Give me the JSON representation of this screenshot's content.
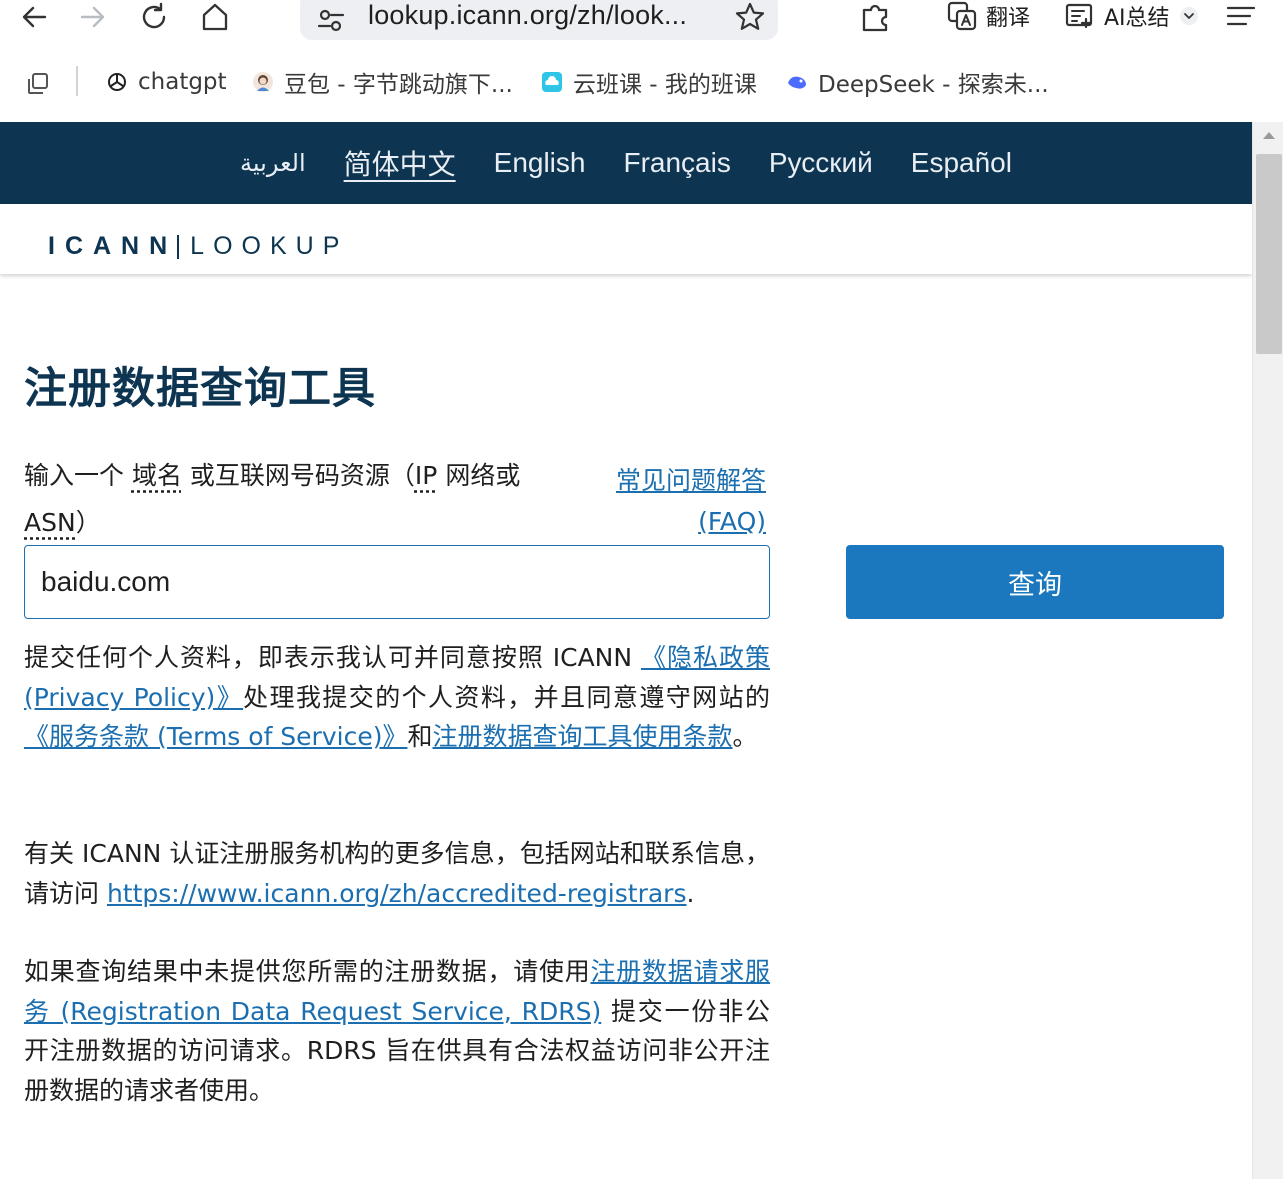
{
  "browser": {
    "url": "lookup.icann.org/zh/look...",
    "translate_label": "翻译",
    "ai_summary_label": "AI总结",
    "bookmarks": [
      {
        "label": "chatgpt",
        "icon": "openai-icon"
      },
      {
        "label": "豆包 - 字节跳动旗下...",
        "icon": "doubao-icon"
      },
      {
        "label": "云班课 - 我的班课",
        "icon": "cloud-class-icon"
      },
      {
        "label": "DeepSeek - 探索未...",
        "icon": "deepseek-icon"
      }
    ]
  },
  "languages": [
    {
      "label": "العربية",
      "active": false
    },
    {
      "label": "简体中文",
      "active": true
    },
    {
      "label": "English",
      "active": false
    },
    {
      "label": "Français",
      "active": false
    },
    {
      "label": "Русский",
      "active": false
    },
    {
      "label": "Español",
      "active": false
    }
  ],
  "brand": {
    "left": "ICANN",
    "right": "LOOKUP"
  },
  "page": {
    "title": "注册数据查询工具",
    "prompt": {
      "t1": "输入一个 ",
      "domain": "域名",
      "t2": " 或互联网号码资源（",
      "ip": "IP",
      "t3": " 网络或 ",
      "asn": "ASN",
      "t4": "）"
    },
    "faq_line1": "常见问题解答",
    "faq_line2": "(FAQ)",
    "search_value": "baidu.com",
    "submit_label": "查询",
    "p1": {
      "t1": "提交任何个人资料，即表示我认可并同意按照 ICANN ",
      "privacy_link": "《隐私政策 (Privacy Policy)》",
      "t2": "处理我提交的个人资料，并且同意遵守网站的",
      "tos_link": "《服务条款 (Terms of Service)》",
      "t3": "和",
      "terms_link": "注册数据查询工具使用条款",
      "t4": "。"
    },
    "p2": {
      "t1": "有关 ICANN 认证注册服务机构的更多信息，包括网站和联系信息，请访问 ",
      "link": "https://www.icann.org/zh/accredited-registrars",
      "t2": "."
    },
    "p3": {
      "t1": "如果查询结果中未提供您所需的注册数据，请使用",
      "link": "注册数据请求服务 (Registration Data Request Service, RDRS)",
      "t2": " 提交一份非公开注册数据的访问请求。RDRS 旨在供具有合法权益访问非公开注册数据的请求者使用。"
    }
  }
}
